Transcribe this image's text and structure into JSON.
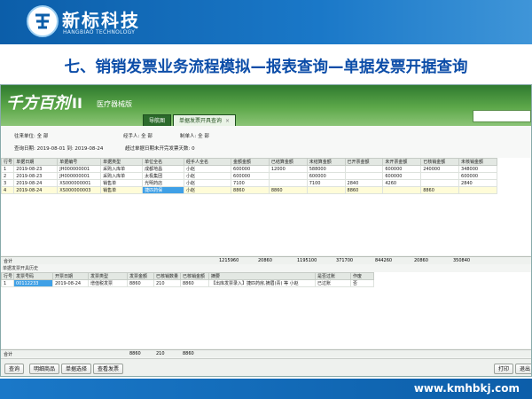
{
  "slide": {
    "logo_cn": "新标科技",
    "logo_en": "HANGBIAO TECHNOLOGY",
    "title": "七、销销发票业务流程模拟—报表查询—单据发票开据查询",
    "footer_url": "www.kmhbkj.com"
  },
  "app": {
    "logo": "千方百剂",
    "logo_version": "II",
    "edition": "医疗器械版",
    "tabs": [
      {
        "label": "导航图"
      },
      {
        "label": "单据发票开具查询"
      }
    ],
    "filters": {
      "unit": "往来单位: 全 部",
      "handler": "经手人: 全 部",
      "maker": "制单人: 全 部",
      "date_range": "查询日期: 2019-08-01 到: 2019-08-24",
      "overdue": "超过单据日期未开完发票天数: 0"
    },
    "main_table": {
      "headers": [
        "行号",
        "单据日期",
        "单据编号",
        "单据类型",
        "单位全名",
        "经手人全名",
        "金额金额",
        "已结算金额",
        "未结算金额",
        "已开票金额",
        "未开票金额",
        "已核销金额",
        "未核销金额"
      ],
      "rows": [
        [
          "1",
          "2019-08-23",
          "JH000000001",
          "采购入库单",
          "成都地昌",
          "小赵",
          "600000",
          "12000",
          "588000",
          "",
          "600000",
          "240000",
          "",
          "348000"
        ],
        [
          "2",
          "2019-08-23",
          "JH000000001",
          "采购入库单",
          "太极集团",
          "小赵",
          "600000",
          "",
          "600000",
          "",
          "600000",
          "",
          "600000",
          ""
        ],
        [
          "3",
          "2019-08-24",
          "XS000000001",
          "销售单",
          "光明药店",
          "小赵",
          "7100",
          "",
          "7100",
          "2840",
          "4260",
          "",
          "",
          "2840"
        ],
        [
          "4",
          "2019-08-24",
          "XS000000003",
          "销售单",
          "捷匹药保",
          "小赵",
          "8860",
          "8860",
          "",
          "8860",
          "",
          "8860",
          "",
          ""
        ]
      ],
      "totals_label": "合计",
      "totals": [
        "1215960",
        "20860",
        "1195100",
        "371700",
        "844260",
        "20860",
        "350840"
      ]
    },
    "history": {
      "title": "单据发票开具历史",
      "headers": [
        "行号",
        "发票号码",
        "开票日期",
        "发票类型",
        "发票金额",
        "已核销数量",
        "已核销金额",
        "摘要",
        "是否过账",
        "作废"
      ],
      "rows": [
        [
          "1",
          "00112233",
          "2019-08-24",
          "增值税发票",
          "8860",
          "210",
          "8860",
          "【出库发票录入】捷匹药房,摘眉(青) 等 小赵",
          "已过账",
          "否"
        ]
      ],
      "totals_label": "合计",
      "totals": [
        "8860",
        "210",
        "8860"
      ]
    },
    "buttons": {
      "query": "查询",
      "detail": "明细商品",
      "select": "单据选择",
      "view_invoice": "查看发票",
      "print": "打印",
      "exit": "退出"
    }
  },
  "colors": {
    "header_blue": "#0c5ea9",
    "title_blue": "#0c4da8",
    "app_green": "#3f8f38",
    "highlight_cell": "#3fa0e6"
  }
}
